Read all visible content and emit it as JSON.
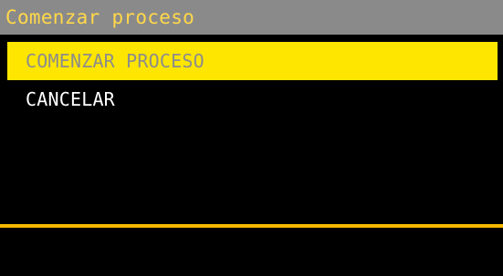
{
  "header": {
    "title": "Comenzar proceso"
  },
  "menu": {
    "items": [
      {
        "label": "COMENZAR PROCESO",
        "selected": true
      },
      {
        "label": "CANCELAR",
        "selected": false
      }
    ]
  },
  "colors": {
    "background": "#000000",
    "title_bar": "#8a8a8a",
    "title_text": "#ffd84a",
    "selection": "#ffe600",
    "selected_text": "#8c8c8c",
    "item_text": "#ffffff",
    "divider": "#f5b800"
  }
}
